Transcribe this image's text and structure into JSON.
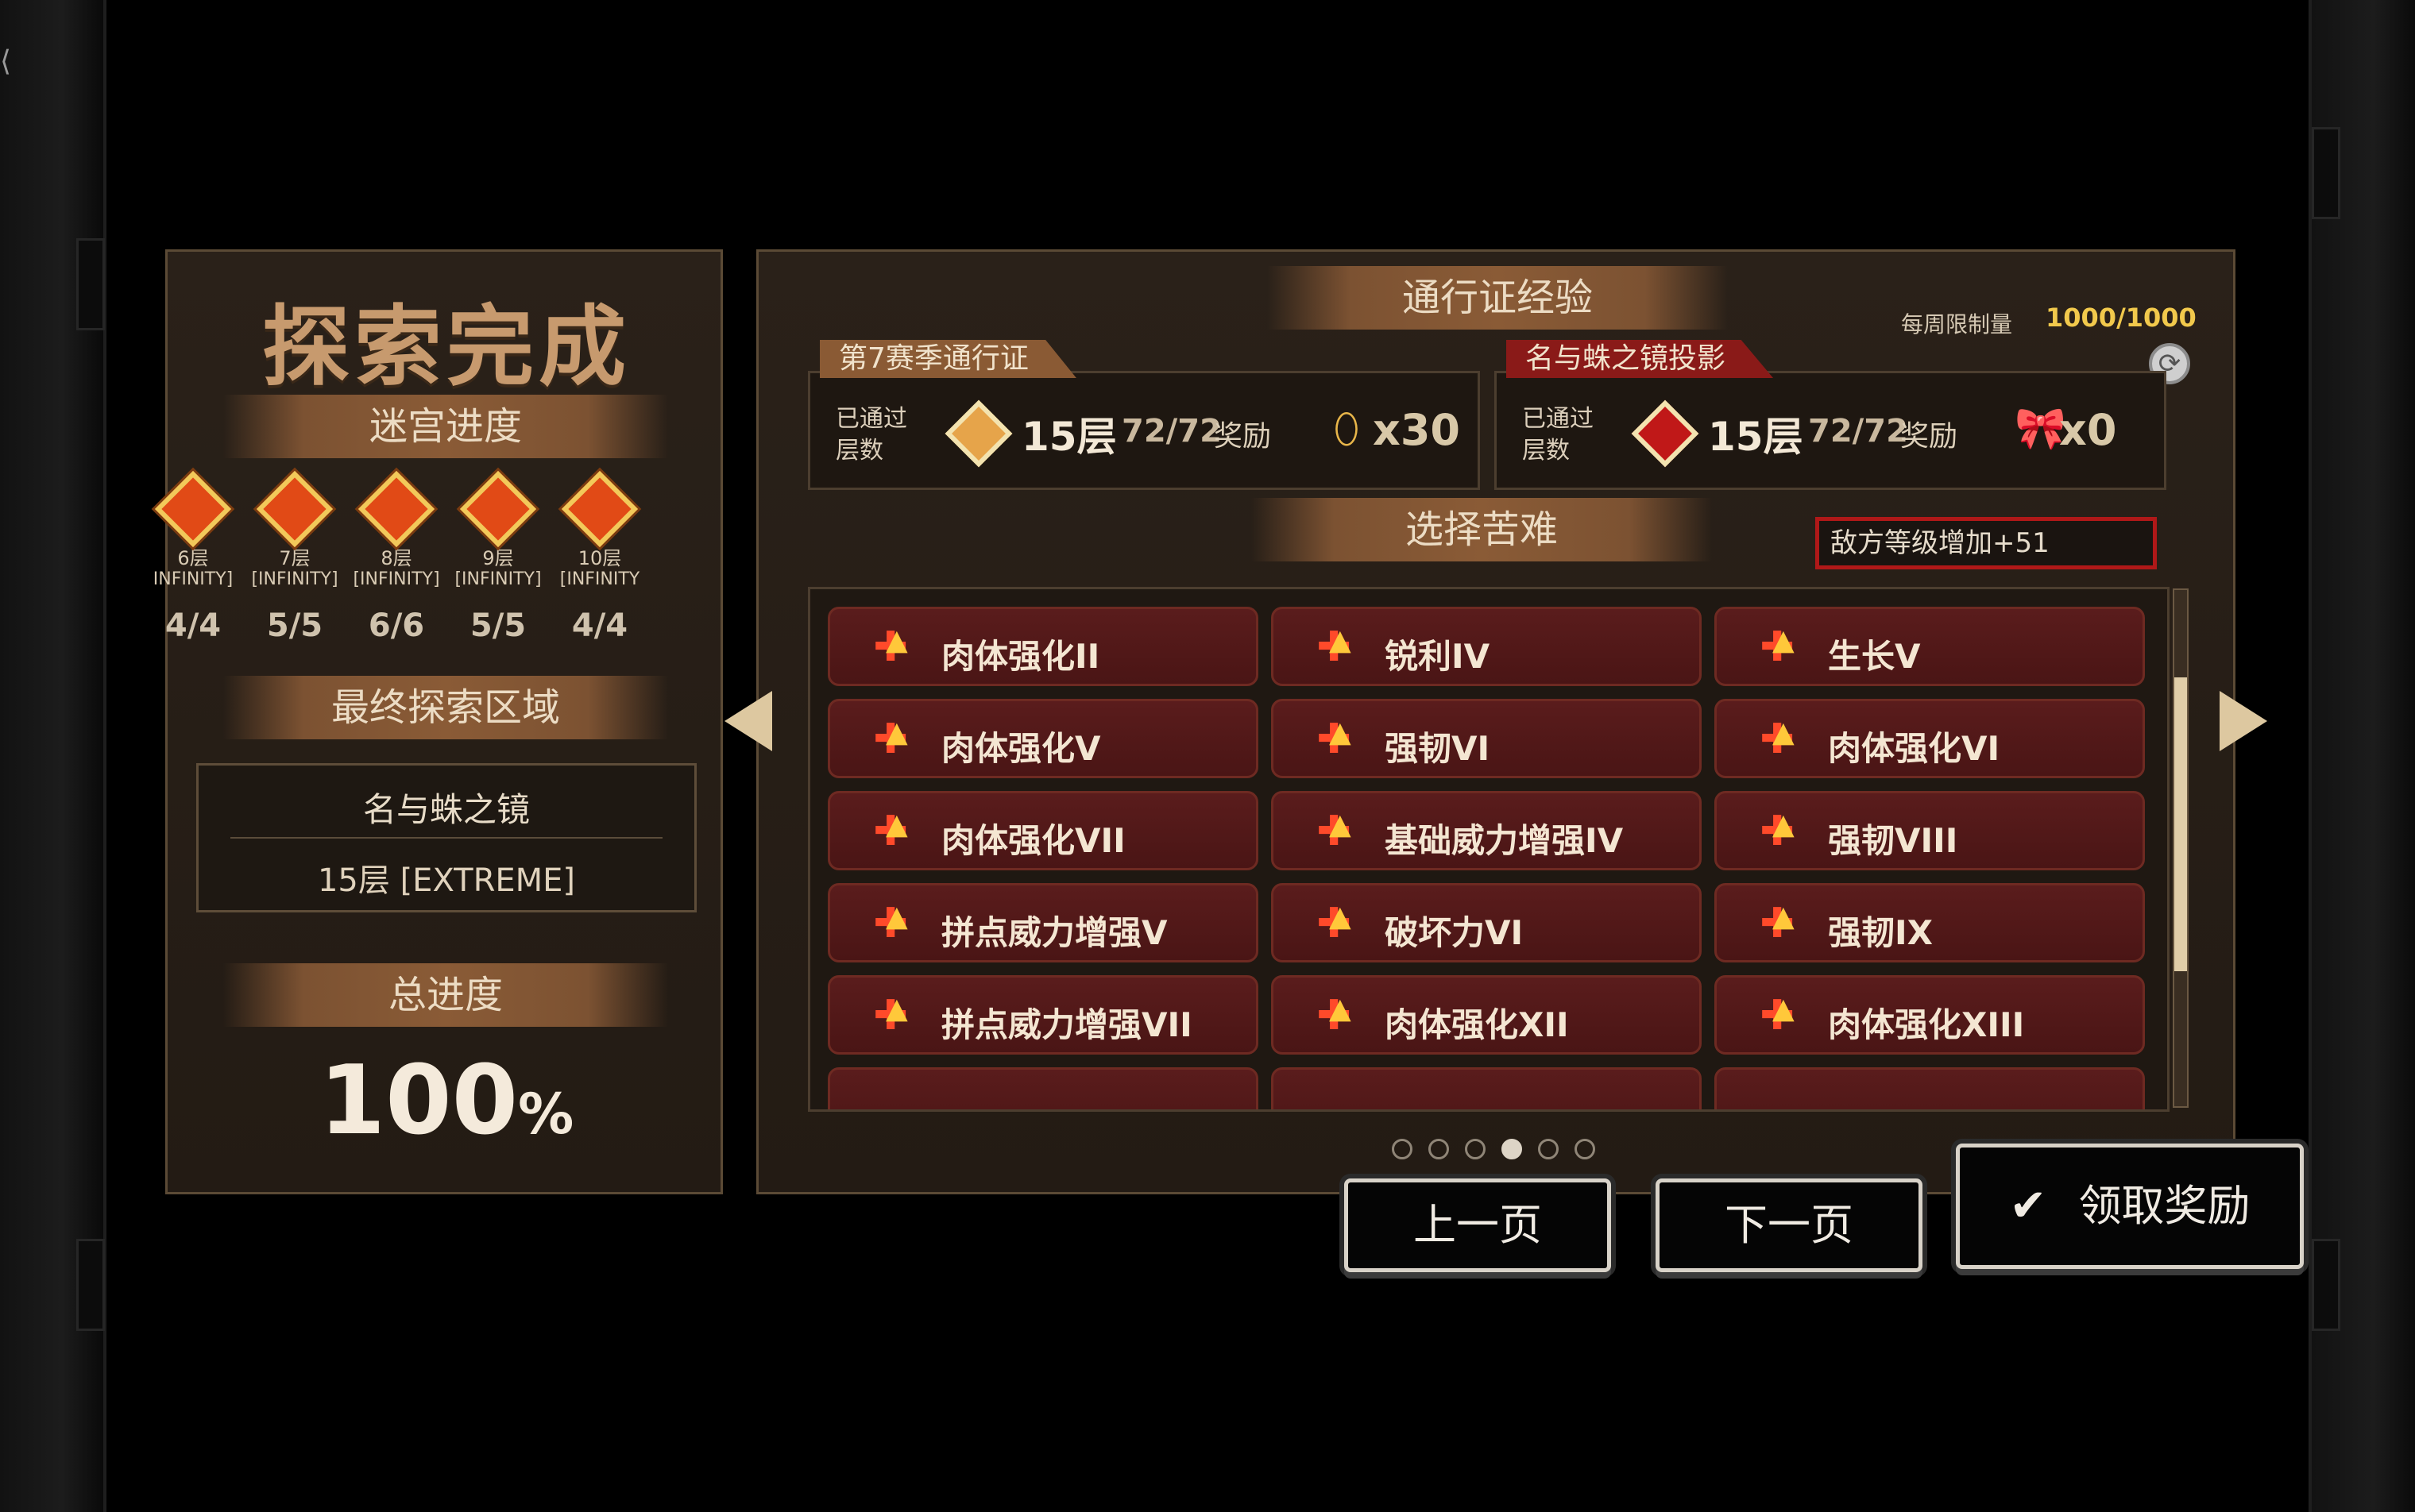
{
  "left": {
    "title": "探索完成",
    "maze_progress_title": "迷宫进度",
    "floors": [
      {
        "name": "6层",
        "tag": "INFINITY]",
        "count": "4/4"
      },
      {
        "name": "7层",
        "tag": "[INFINITY]",
        "count": "5/5"
      },
      {
        "name": "8层",
        "tag": "[INFINITY]",
        "count": "6/6"
      },
      {
        "name": "9层",
        "tag": "[INFINITY]",
        "count": "5/5"
      },
      {
        "name": "10层",
        "tag": "[INFINITY",
        "count": "4/4"
      }
    ],
    "final_zone_title": "最终探索区域",
    "final_zone_name": "名与蛛之镜",
    "final_zone_level": "15层 [EXTREME]",
    "total_title": "总进度",
    "total_value": "100",
    "total_unit": "%"
  },
  "right": {
    "pass_title": "通行证经验",
    "weekly_limit_label": "每周限制量",
    "weekly_limit_value": "1000/1000",
    "pass_cards": [
      {
        "label": "第7赛季通行证",
        "passed_label": "已通过\n层数",
        "floor": "15层",
        "progress": "72/72",
        "reward_label": "奖励",
        "reward_count": "x30",
        "reward_icon": "ticket-icon",
        "label_color": "#8a5a34",
        "diamond_color": "#e6a44a"
      },
      {
        "label": "名与蛛之镜投影",
        "passed_label": "已通过\n层数",
        "floor": "15层",
        "progress": "72/72",
        "reward_label": "奖励",
        "reward_count": "x0",
        "reward_icon": "ribbon-icon",
        "label_color": "#8a1a18",
        "diamond_color": "#c01818"
      }
    ],
    "hardship_title": "选择苦难",
    "enemy_level_text": "敌方等级增加+51",
    "hardships": [
      "肉体强化II",
      "锐利IV",
      "生长V",
      "肉体强化V",
      "强韧VI",
      "肉体强化VI",
      "肉体强化VII",
      "基础威力增强IV",
      "强韧VIII",
      "拼点威力增强V",
      "破坏力VI",
      "强韧IX",
      "拼点威力增强VII",
      "肉体强化XII",
      "肉体强化XIII"
    ],
    "page_dots": 6,
    "active_dot": 3
  },
  "buttons": {
    "prev_label": "上一页",
    "next_label": "下一页",
    "claim_label": "领取奖励"
  },
  "colors": {
    "accent_gold": "#ddc8a0",
    "card_red": "#5a1c1c",
    "enemy_border": "#b01818"
  }
}
